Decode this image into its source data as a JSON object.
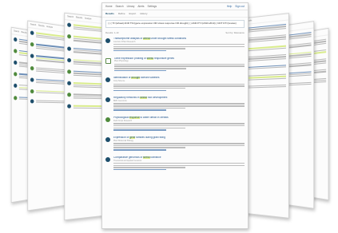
{
  "main": {
    "header_left": [
      "Home",
      "Search",
      "Library",
      "Alerts",
      "Settings"
    ],
    "header_right": [
      "Help",
      "Sign out"
    ],
    "tabs": [
      {
        "label": "Results",
        "active": true
      },
      {
        "label": "Refine",
        "active": false
      },
      {
        "label": "Export",
        "active": false
      },
      {
        "label": "History",
        "active": false
      }
    ],
    "query": "( ( ( TI=(wheat) AND TS=(gene expression OR stress response OR drought) ) ) AND PY=(2010-2014) ) NOT DT=(review)",
    "results_label": "Results: 1-10",
    "sort_label": "Sort by: Relevance",
    "results": [
      {
        "icon": "dot",
        "title_pre": "Transcriptome analysis of ",
        "title_mark": "wheat",
        "title_post": " under drought stress conditions",
        "meta": "Journal of Plant Research"
      },
      {
        "icon": "square",
        "title_pre": "Gene expression profiling of ",
        "title_mark": "stress",
        "title_post": " responsive genes",
        "meta": "Plant Physiology"
      },
      {
        "icon": "dot",
        "title_pre": "Identification of ",
        "title_mark": "drought",
        "title_post": " tolerant varieties",
        "meta": "Crop Science"
      },
      {
        "icon": "dot",
        "title_pre": "Regulatory networks in ",
        "title_mark": "wheat",
        "title_post": " root development",
        "meta": "BMC Genomics"
      },
      {
        "icon": "dot-green",
        "title_pre": "Physiological ",
        "title_mark": "response",
        "title_post": " to water deficit in cereals",
        "meta": "Field Crops Research"
      },
      {
        "icon": "dot",
        "title_pre": "Expression of ",
        "title_mark": "gene",
        "title_post": " families during grain filling",
        "meta": "Plant Molecular Biology"
      },
      {
        "icon": "dot",
        "title_pre": "Comparative genomics of ",
        "title_mark": "stress",
        "title_post": " tolerance",
        "meta": "Theoretical and Applied Genetics"
      }
    ]
  },
  "side_tabs": [
    "Search",
    "Results",
    "Analyze"
  ]
}
